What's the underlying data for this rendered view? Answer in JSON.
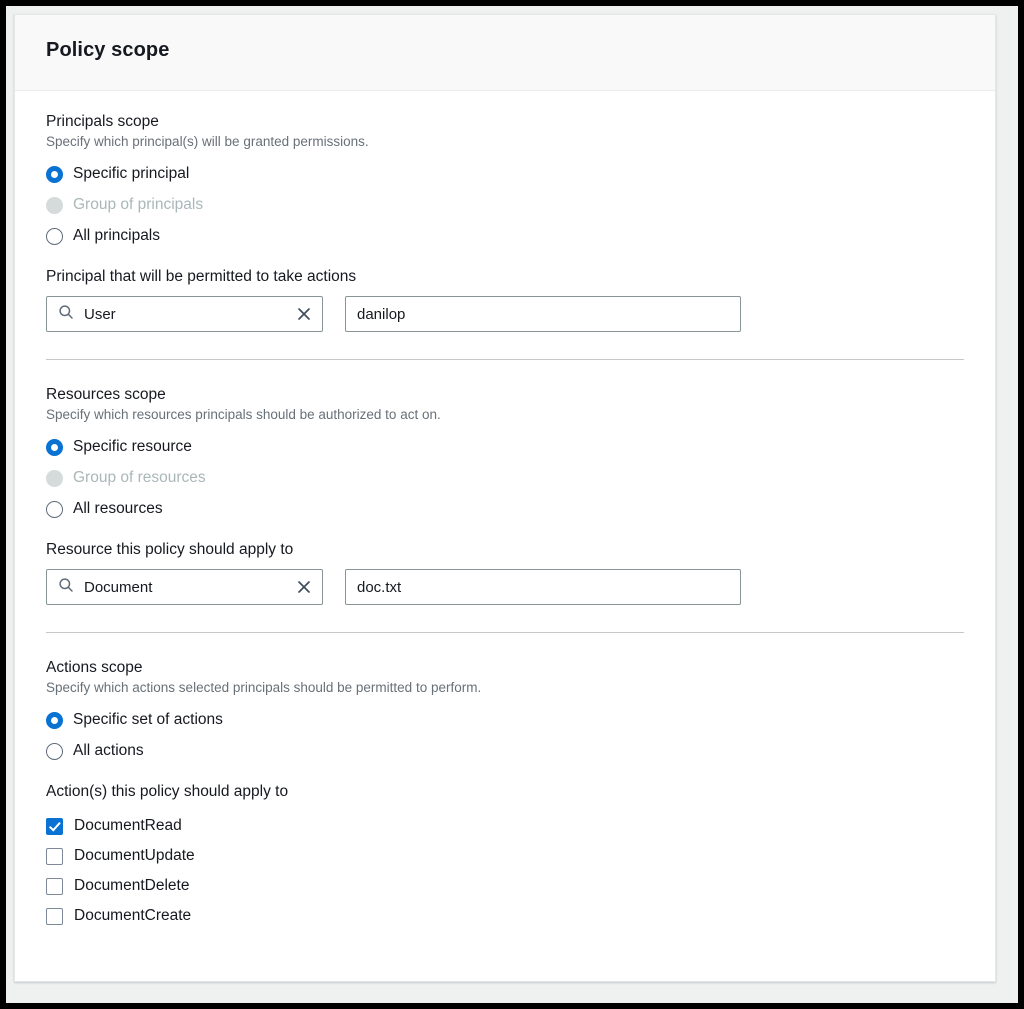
{
  "card": {
    "title": "Policy scope"
  },
  "principals": {
    "section_title": "Principals scope",
    "section_desc": "Specify which principal(s) will be granted permissions.",
    "options": [
      {
        "label": "Specific principal",
        "state": "on"
      },
      {
        "label": "Group of principals",
        "state": "disabled"
      },
      {
        "label": "All principals",
        "state": "off"
      }
    ],
    "field_label": "Principal that will be permitted to take actions",
    "type_value": "User",
    "identifier_value": "danilop"
  },
  "resources": {
    "section_title": "Resources scope",
    "section_desc": "Specify which resources principals should be authorized to act on.",
    "options": [
      {
        "label": "Specific resource",
        "state": "on"
      },
      {
        "label": "Group of resources",
        "state": "disabled"
      },
      {
        "label": "All resources",
        "state": "off"
      }
    ],
    "field_label": "Resource this policy should apply to",
    "type_value": "Document",
    "identifier_value": "doc.txt"
  },
  "actions": {
    "section_title": "Actions scope",
    "section_desc": "Specify which actions selected principals should be permitted to perform.",
    "options": [
      {
        "label": "Specific set of actions",
        "state": "on"
      },
      {
        "label": "All actions",
        "state": "off"
      }
    ],
    "field_label": "Action(s) this policy should apply to",
    "items": [
      {
        "label": "DocumentRead",
        "checked": true
      },
      {
        "label": "DocumentUpdate",
        "checked": false
      },
      {
        "label": "DocumentDelete",
        "checked": false
      },
      {
        "label": "DocumentCreate",
        "checked": false
      }
    ]
  },
  "colors": {
    "accent": "#0972d3",
    "text": "#16191f",
    "muted": "#687078",
    "disabled": "#aab7b8"
  }
}
